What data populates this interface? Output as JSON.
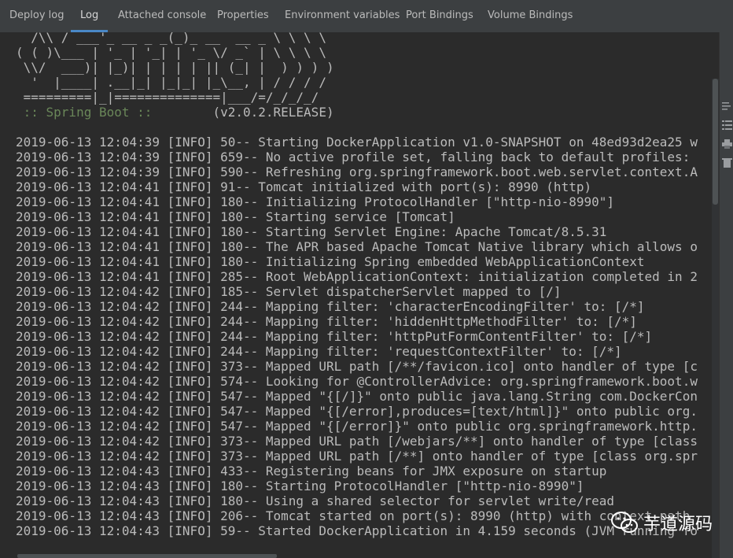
{
  "tabs": [
    {
      "label": "Deploy log",
      "active": false
    },
    {
      "label": "Log",
      "active": true
    },
    {
      "label": "Attached console",
      "active": false
    },
    {
      "label": "Properties",
      "active": false
    },
    {
      "label": "Environment variables",
      "active": false
    },
    {
      "label": "Port Bindings",
      "active": false
    },
    {
      "label": "Volume Bindings",
      "active": false
    }
  ],
  "banner": [
    "  /\\\\ / ___'_ __ _ _(_)_ __  __ _ \\ \\ \\ \\",
    "( ( )\\___ | '_ | '_| | '_ \\/ _` | \\ \\ \\ \\",
    " \\\\/  ___)| |_)| | | | | || (_| |  ) ) ) )",
    "  '  |____| .__|_| |_|_| |_\\__, | / / / /",
    " =========|_|==============|___/=/_/_/_/"
  ],
  "spring_label": " :: Spring Boot ::",
  "spring_version": "(v2.0.2.RELEASE)",
  "log_lines": [
    "2019-06-13 12:04:39 [INFO] 50-- Starting DockerApplication v1.0-SNAPSHOT on 48ed93d2ea25 w",
    "2019-06-13 12:04:39 [INFO] 659-- No active profile set, falling back to default profiles: ",
    "2019-06-13 12:04:39 [INFO] 590-- Refreshing org.springframework.boot.web.servlet.context.A",
    "2019-06-13 12:04:41 [INFO] 91-- Tomcat initialized with port(s): 8990 (http)",
    "2019-06-13 12:04:41 [INFO] 180-- Initializing ProtocolHandler [\"http-nio-8990\"]",
    "2019-06-13 12:04:41 [INFO] 180-- Starting service [Tomcat]",
    "2019-06-13 12:04:41 [INFO] 180-- Starting Servlet Engine: Apache Tomcat/8.5.31",
    "2019-06-13 12:04:41 [INFO] 180-- The APR based Apache Tomcat Native library which allows o",
    "2019-06-13 12:04:41 [INFO] 180-- Initializing Spring embedded WebApplicationContext",
    "2019-06-13 12:04:41 [INFO] 285-- Root WebApplicationContext: initialization completed in 2",
    "2019-06-13 12:04:42 [INFO] 185-- Servlet dispatcherServlet mapped to [/]",
    "2019-06-13 12:04:42 [INFO] 244-- Mapping filter: 'characterEncodingFilter' to: [/*]",
    "2019-06-13 12:04:42 [INFO] 244-- Mapping filter: 'hiddenHttpMethodFilter' to: [/*]",
    "2019-06-13 12:04:42 [INFO] 244-- Mapping filter: 'httpPutFormContentFilter' to: [/*]",
    "2019-06-13 12:04:42 [INFO] 244-- Mapping filter: 'requestContextFilter' to: [/*]",
    "2019-06-13 12:04:42 [INFO] 373-- Mapped URL path [/**/favicon.ico] onto handler of type [c",
    "2019-06-13 12:04:42 [INFO] 574-- Looking for @ControllerAdvice: org.springframework.boot.w",
    "2019-06-13 12:04:42 [INFO] 547-- Mapped \"{[/]}\" onto public java.lang.String com.DockerCon",
    "2019-06-13 12:04:42 [INFO] 547-- Mapped \"{[/error],produces=[text/html]}\" onto public org.",
    "2019-06-13 12:04:42 [INFO] 547-- Mapped \"{[/error]}\" onto public org.springframework.http.",
    "2019-06-13 12:04:42 [INFO] 373-- Mapped URL path [/webjars/**] onto handler of type [class",
    "2019-06-13 12:04:42 [INFO] 373-- Mapped URL path [/**] onto handler of type [class org.spr",
    "2019-06-13 12:04:43 [INFO] 433-- Registering beans for JMX exposure on startup",
    "2019-06-13 12:04:43 [INFO] 180-- Starting ProtocolHandler [\"http-nio-8990\"]",
    "2019-06-13 12:04:43 [INFO] 180-- Using a shared selector for servlet write/read",
    "2019-06-13 12:04:43 [INFO] 206-- Tomcat started on port(s): 8990 (http) with context path ",
    "2019-06-13 12:04:43 [INFO] 59-- Started DockerApplication in 4.159 seconds (JVM running fo"
  ],
  "watermark": {
    "text": "芋道源码",
    "icon": "wechat-icon"
  },
  "colors": {
    "background": "#2b2b2b",
    "tabbar": "#3c3f41",
    "text": "#bbbbbb",
    "spring_label": "#6a8759",
    "active_tab_underline": "#4a88c7"
  }
}
